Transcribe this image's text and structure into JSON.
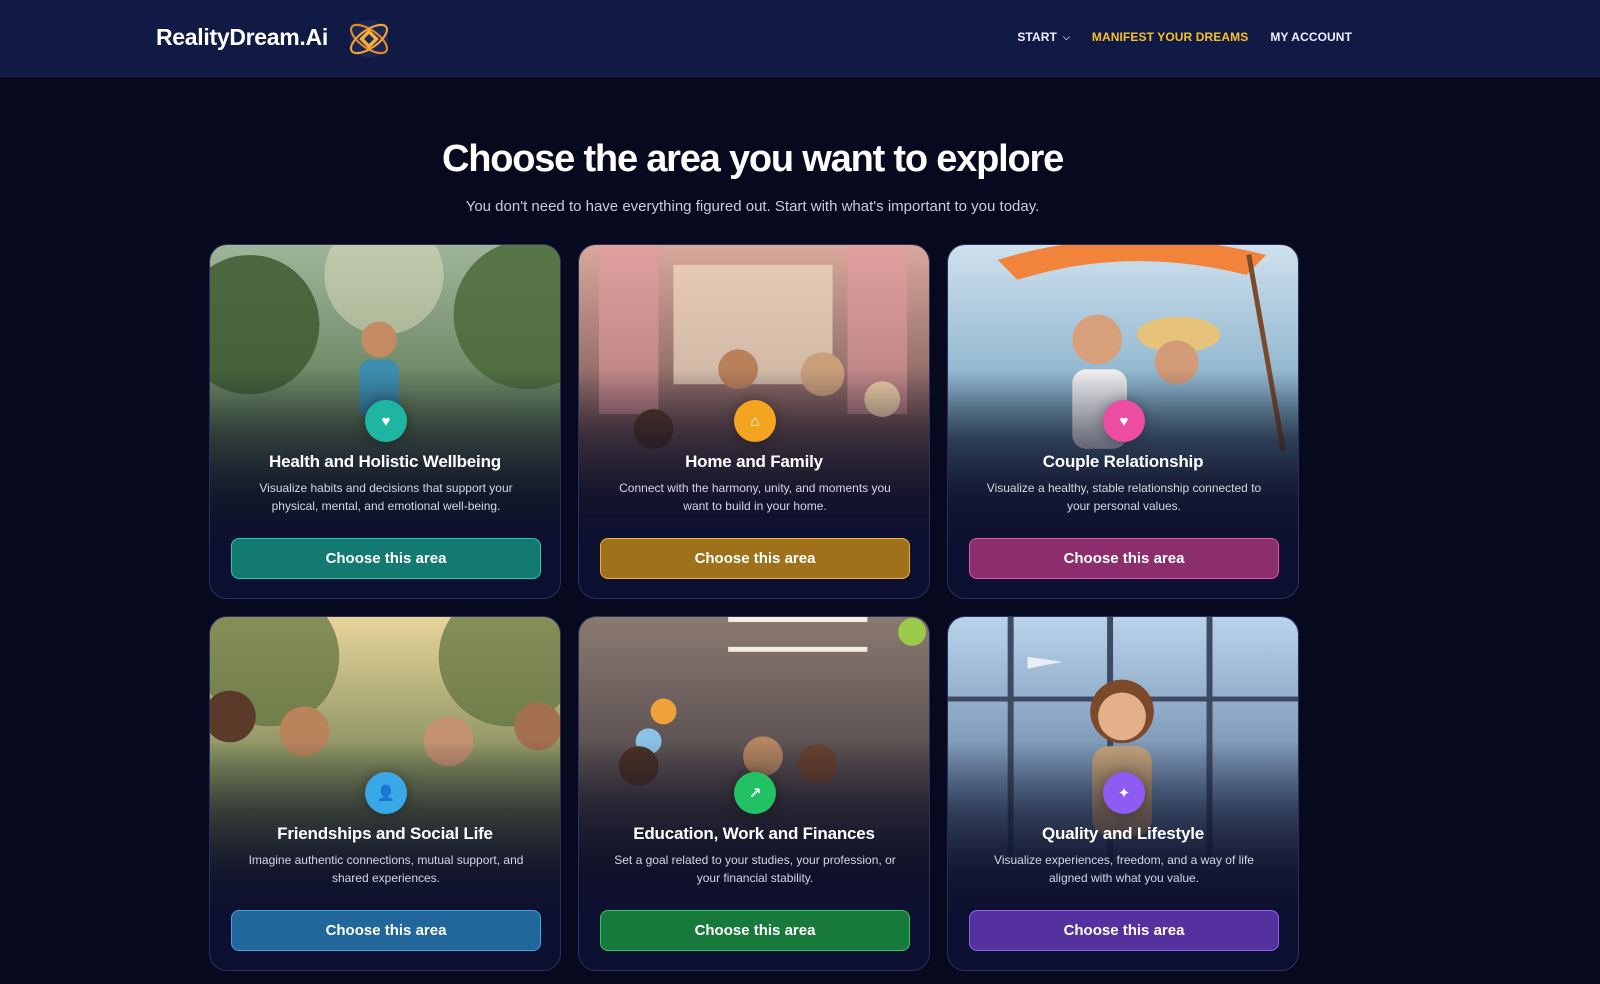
{
  "header": {
    "brand": "RealityDream.Ai",
    "nav": [
      {
        "label": "START",
        "has_dropdown": true,
        "active": false
      },
      {
        "label": "MANIFEST YOUR DREAMS",
        "active": true
      },
      {
        "label": "MY ACCOUNT",
        "active": false
      }
    ]
  },
  "main": {
    "title": "Choose the area you want to explore",
    "subtitle": "You don't need to have everything figured out. Start with what's important to you today.",
    "cards": [
      {
        "title": "Health and Holistic Wellbeing",
        "description": "Visualize habits and decisions that support your physical, mental, and emotional well-being.",
        "button": "Choose this area",
        "icon": "heart-icon",
        "accent": "#1fb5a3",
        "button_color": "#137a72"
      },
      {
        "title": "Home and Family",
        "description": "Connect with the harmony, unity, and moments you want to build in your home.",
        "button": "Choose this area",
        "icon": "home-icon",
        "accent": "#f3a51f",
        "button_color": "#a0711b"
      },
      {
        "title": "Couple Relationship",
        "description": "Visualize a healthy, stable relationship connected to your personal values.",
        "button": "Choose this area",
        "icon": "heart-icon",
        "accent": "#ec4da0",
        "button_color": "#8d2e6c"
      },
      {
        "title": "Friendships and Social Life",
        "description": "Imagine authentic connections, mutual support, and shared experiences.",
        "button": "Choose this area",
        "icon": "person-icon",
        "accent": "#3aa8e6",
        "button_color": "#21679b"
      },
      {
        "title": "Education, Work and Finances",
        "description": "Set a goal related to your studies, your profession, or your financial stability.",
        "button": "Choose this area",
        "icon": "trend-up-icon",
        "accent": "#22c163",
        "button_color": "#177a3b"
      },
      {
        "title": "Quality and Lifestyle",
        "description": "Visualize experiences, freedom, and a way of life aligned with what you value.",
        "button": "Choose this area",
        "icon": "sparkle-icon",
        "accent": "#8e5cf2",
        "button_color": "#55309f"
      }
    ]
  }
}
